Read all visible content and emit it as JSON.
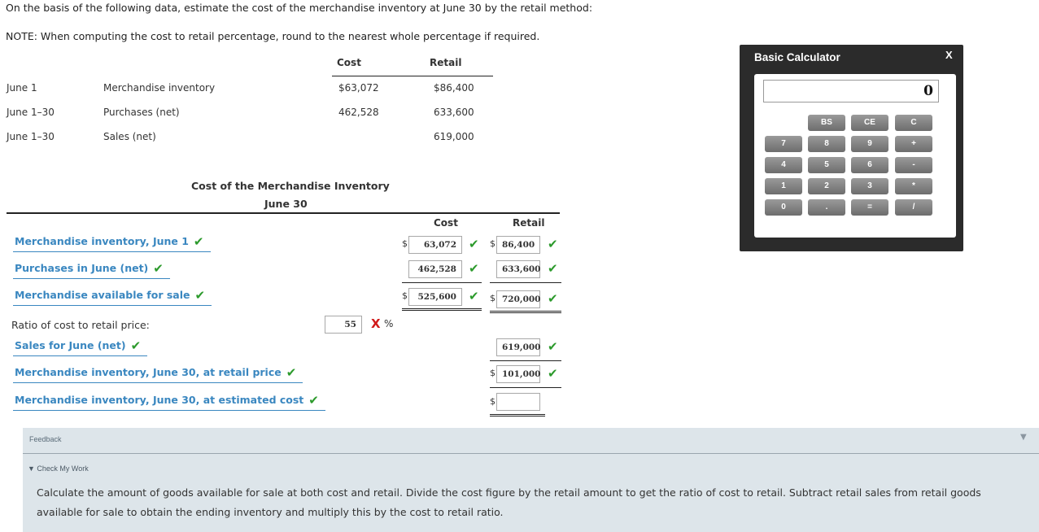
{
  "instructions": {
    "intro": "On the basis of the following data, estimate the cost of the merchandise inventory at June 30 by the retail method:",
    "note": "NOTE: When computing the cost to retail percentage, round to the nearest whole percentage if required."
  },
  "data_table": {
    "headers": {
      "cost": "Cost",
      "retail": "Retail"
    },
    "rows": [
      {
        "date": "June 1",
        "item": "Merchandise inventory",
        "cost": "$63,072",
        "retail": "$86,400"
      },
      {
        "date": "June 1–30",
        "item": "Purchases (net)",
        "cost": "462,528",
        "retail": "633,600"
      },
      {
        "date": "June 1–30",
        "item": "Sales (net)",
        "cost": "",
        "retail": "619,000"
      }
    ]
  },
  "schedule": {
    "title": "Cost of the Merchandise Inventory",
    "subtitle": "June 30",
    "headers": {
      "cost": "Cost",
      "retail": "Retail"
    },
    "currency": "$",
    "rows": {
      "inv_june1": {
        "label": "Merchandise inventory, June 1",
        "cost": "63,072",
        "retail": "86,400"
      },
      "purchases": {
        "label": "Purchases in June (net)",
        "cost": "462,528",
        "retail": "633,600"
      },
      "available": {
        "label": "Merchandise available for sale",
        "cost": "525,600",
        "retail": "720,000"
      },
      "ratio": {
        "label": "Ratio of cost to retail price:",
        "value": "55",
        "unit": "%"
      },
      "sales": {
        "label": "Sales for June (net)",
        "retail": "619,000"
      },
      "inv_retail": {
        "label": "Merchandise inventory, June 30, at retail price",
        "retail": "101,000"
      },
      "inv_cost": {
        "label": "Merchandise inventory, June 30, at estimated cost",
        "retail": ""
      }
    },
    "marks": {
      "correct": "✔",
      "incorrect": "X"
    }
  },
  "calculator": {
    "title": "Basic Calculator",
    "close": "X",
    "display": "0",
    "keys": [
      "BS",
      "CE",
      "C",
      "7",
      "8",
      "9",
      "+",
      "4",
      "5",
      "6",
      "-",
      "1",
      "2",
      "3",
      "*",
      "0",
      ".",
      "=",
      "/"
    ]
  },
  "feedback": {
    "label": "Feedback",
    "caret": "▼",
    "section": "▼ Check My Work",
    "text": "Calculate the amount of goods available for sale at both cost and retail. Divide the cost figure by the retail amount to get the ratio of cost to retail. Subtract retail sales from retail goods available for sale to obtain the ending inventory and multiply this by the cost to retail ratio."
  },
  "colors": {
    "link_blue": "#3a87c0",
    "check_green": "#2c9a2c",
    "error_red": "#d11a1a",
    "calc_bg": "#2b2b2b",
    "feedback_bg": "#dde5ea"
  }
}
